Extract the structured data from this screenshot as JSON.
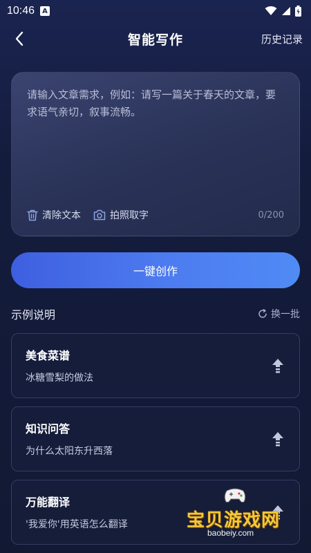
{
  "status_bar": {
    "time": "10:46",
    "notification_letter": "A"
  },
  "nav": {
    "title": "智能写作",
    "history_label": "历史记录"
  },
  "editor": {
    "placeholder": "请输入文章需求，例如：请写一篇关于春天的文章，要求语气亲切，叙事流畅。",
    "clear_label": "清除文本",
    "photo_label": "拍照取字",
    "counter": "0/200"
  },
  "create_button": {
    "label": "一键创作"
  },
  "examples": {
    "header": "示例说明",
    "refresh_label": "换一批",
    "items": [
      {
        "title": "美食菜谱",
        "subtitle": "冰糖雪梨的做法"
      },
      {
        "title": "知识问答",
        "subtitle": "为什么太阳东升西落"
      },
      {
        "title": "万能翻译",
        "subtitle": "'我爱你'用英语怎么翻译"
      }
    ]
  },
  "watermark": {
    "name": "宝贝游戏网",
    "url": "baobeiy.com"
  },
  "colors": {
    "background": "#141c3d",
    "button_start": "#3e5fe0",
    "button_end": "#4f8bf5",
    "card_border": "#343d66",
    "watermark": "#f5c83a"
  }
}
